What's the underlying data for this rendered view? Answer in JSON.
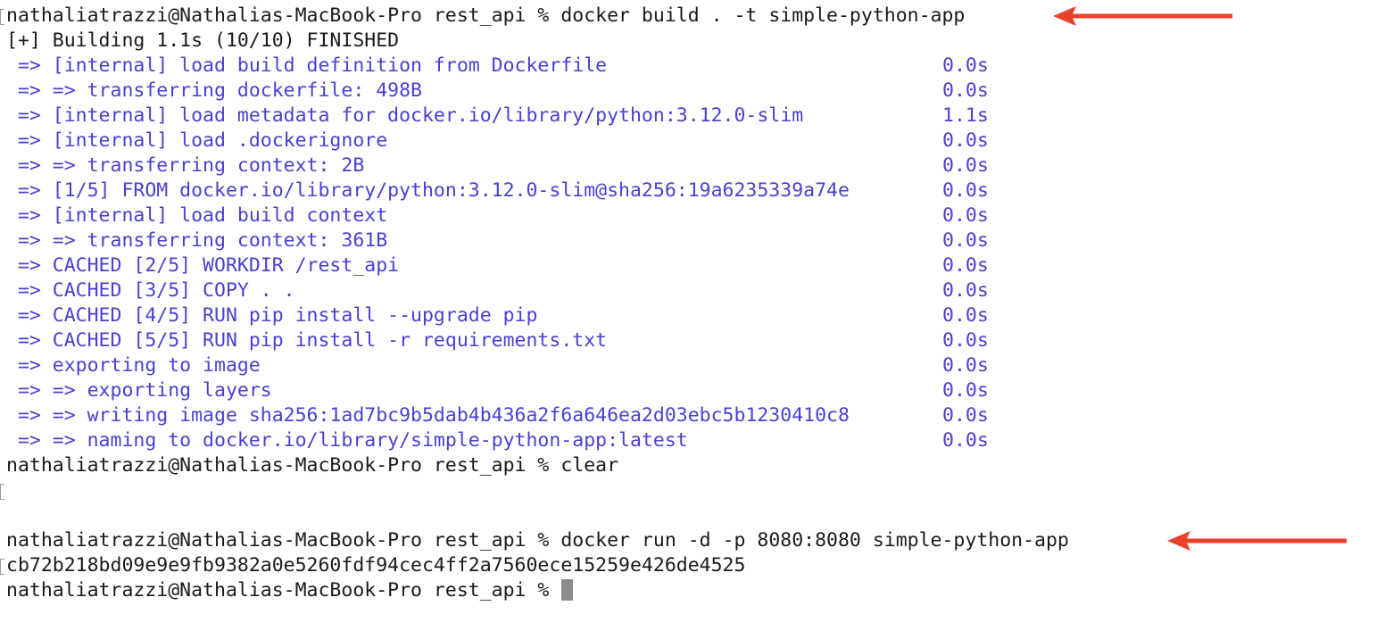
{
  "terminal": {
    "prompt": "nathaliatrazzi@Nathalias-MacBook-Pro rest_api % ",
    "cmd_build": "docker build . -t simple-python-app",
    "build_header": "[+] Building 1.1s (10/10) FINISHED",
    "steps": [
      {
        "text": " => [internal] load build definition from Dockerfile",
        "time": "0.0s"
      },
      {
        "text": " => => transferring dockerfile: 498B",
        "time": "0.0s"
      },
      {
        "text": " => [internal] load metadata for docker.io/library/python:3.12.0-slim",
        "time": "1.1s"
      },
      {
        "text": " => [internal] load .dockerignore",
        "time": "0.0s"
      },
      {
        "text": " => => transferring context: 2B",
        "time": "0.0s"
      },
      {
        "text": " => [1/5] FROM docker.io/library/python:3.12.0-slim@sha256:19a6235339a74e",
        "time": "0.0s"
      },
      {
        "text": " => [internal] load build context",
        "time": "0.0s"
      },
      {
        "text": " => => transferring context: 361B",
        "time": "0.0s"
      },
      {
        "text": " => CACHED [2/5] WORKDIR /rest_api",
        "time": "0.0s"
      },
      {
        "text": " => CACHED [3/5] COPY . .",
        "time": "0.0s"
      },
      {
        "text": " => CACHED [4/5] RUN pip install --upgrade pip",
        "time": "0.0s"
      },
      {
        "text": " => CACHED [5/5] RUN pip install -r requirements.txt",
        "time": "0.0s"
      },
      {
        "text": " => exporting to image",
        "time": "0.0s"
      },
      {
        "text": " => => exporting layers",
        "time": "0.0s"
      },
      {
        "text": " => => writing image sha256:1ad7bc9b5dab4b436a2f6a646ea2d03ebc5b1230410c8",
        "time": "0.0s"
      },
      {
        "text": " => => naming to docker.io/library/simple-python-app:latest",
        "time": "0.0s"
      }
    ],
    "cmd_clear": "clear",
    "cmd_run": "docker run -d -p 8080:8080 simple-python-app",
    "container_id": "cb72b218bd09e9e9fb9382a0e5260fdf94cec4ff2a7560ece15259e426de4525"
  },
  "colors": {
    "output_text": "#4b3fd1",
    "command_text": "#1a1a1a",
    "arrow": "#e8412c",
    "cursor": "#8c8c8c"
  },
  "icons": {
    "annotation_arrow": "left-pointing-arrow"
  }
}
